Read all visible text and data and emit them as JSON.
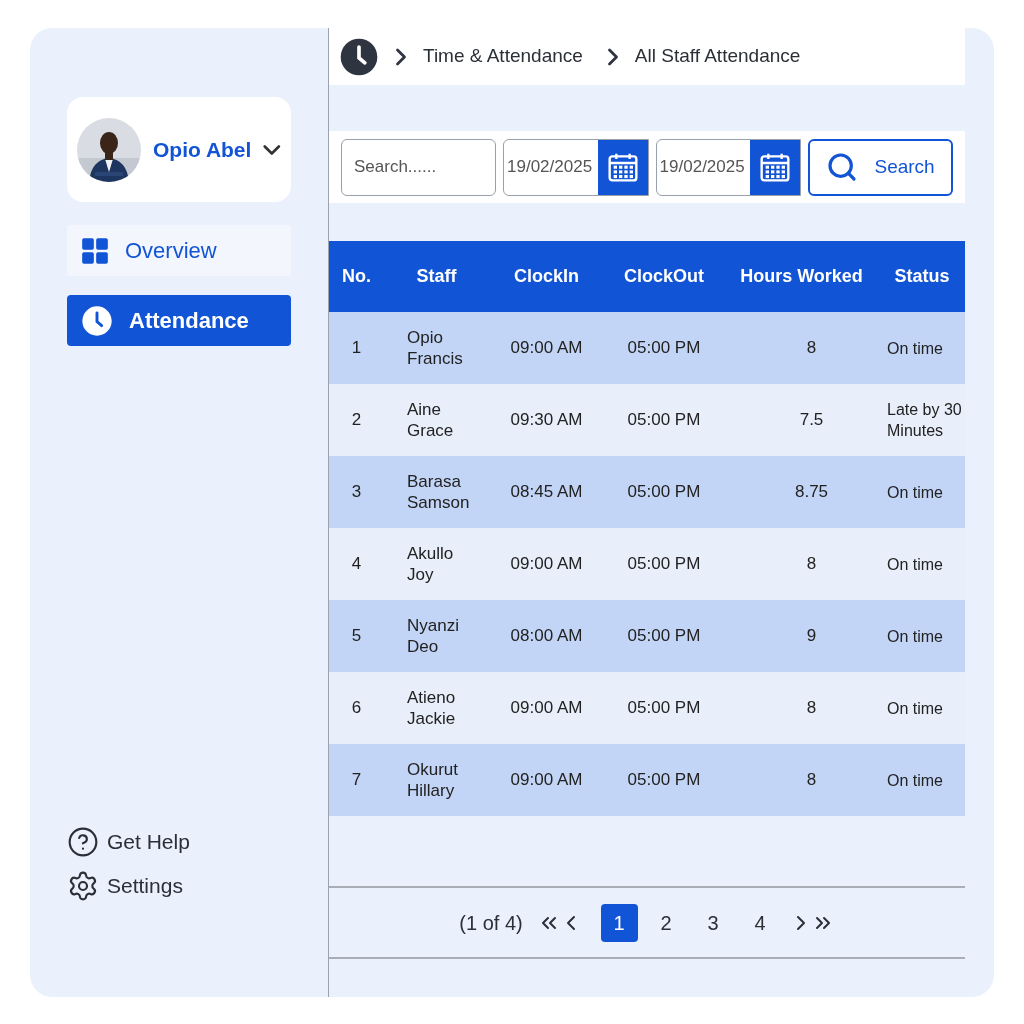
{
  "sidebar": {
    "profile": {
      "name": "Opio Abel",
      "expanded": false
    },
    "nav": [
      {
        "label": "Overview",
        "selected": false
      },
      {
        "label": "Attendance",
        "selected": true
      }
    ],
    "footer": [
      "Get Help",
      "Settings"
    ]
  },
  "breadcrumb": [
    "Time & Attendance",
    "All Staff Attendance"
  ],
  "filters": {
    "search": {
      "placeholder": "Search......"
    },
    "dates": [
      "19/02/2025",
      "19/02/2025"
    ],
    "button": "Search"
  },
  "table": {
    "columns": [
      "No.",
      "Staff",
      "ClockIn",
      "ClockOut",
      "Hours Worked",
      "Status"
    ],
    "rows": [
      [
        "1",
        "Opio Francis",
        "09:00 AM",
        "05:00 PM",
        "8",
        "On time"
      ],
      [
        "2",
        "Aine Grace",
        "09:30 AM",
        "05:00 PM",
        "7.5",
        "Late by 30 Minutes"
      ],
      [
        "3",
        "Barasa Samson",
        "08:45 AM",
        "05:00 PM",
        "8.75",
        "On time"
      ],
      [
        "4",
        "Akullo Joy",
        "09:00 AM",
        "05:00 PM",
        "8",
        "On time"
      ],
      [
        "5",
        "Nyanzi Deo",
        "08:00 AM",
        "05:00 PM",
        "9",
        "On time"
      ],
      [
        "6",
        "Atieno Jackie",
        "09:00 AM",
        "05:00 PM",
        "8",
        "On time"
      ],
      [
        "7",
        "Okurut Hillary",
        "09:00 AM",
        "05:00 PM",
        "8",
        "On time"
      ]
    ]
  },
  "pagination": {
    "summary": "(1 of 4)",
    "pages": [
      {
        "label": "1",
        "selected": true
      },
      {
        "label": "2",
        "selected": false
      },
      {
        "label": "3",
        "selected": false
      },
      {
        "label": "4",
        "selected": false
      }
    ]
  }
}
